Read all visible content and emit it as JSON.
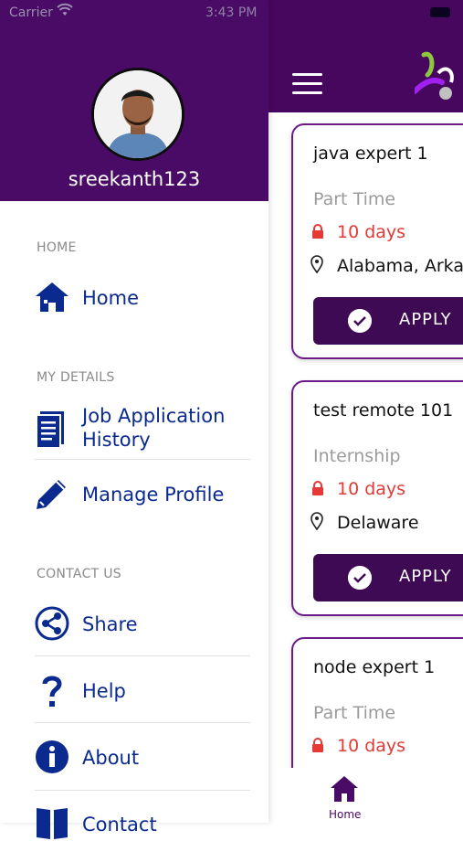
{
  "status_bar": {
    "carrier": "Carrier",
    "time": "3:43 PM"
  },
  "drawer": {
    "username": "sreekanth123",
    "sections": {
      "home": "HOME",
      "my_details": "MY DETAILS",
      "contact_us": "CONTACT US"
    },
    "items": {
      "home": "Home",
      "job_history_line1": "Job Application",
      "job_history_line2": "History",
      "manage_profile": "Manage Profile",
      "share": "Share",
      "help": "Help",
      "about": "About",
      "contact": "Contact"
    },
    "colors": {
      "header": "#4a0b66",
      "item_text": "#0a2a8f"
    }
  },
  "jobs": [
    {
      "title": "java expert 1",
      "type": "Part Time",
      "days": "10 days",
      "location": "Alabama, Arkar",
      "apply_label": "APPLY"
    },
    {
      "title": "test remote 101",
      "type": "Internship",
      "days": "10 days",
      "location": "Delaware",
      "apply_label": "APPLY"
    },
    {
      "title": "node expert 1",
      "type": "Part Time",
      "days": "10 days"
    }
  ],
  "tabbar": {
    "home_label": "Home"
  }
}
